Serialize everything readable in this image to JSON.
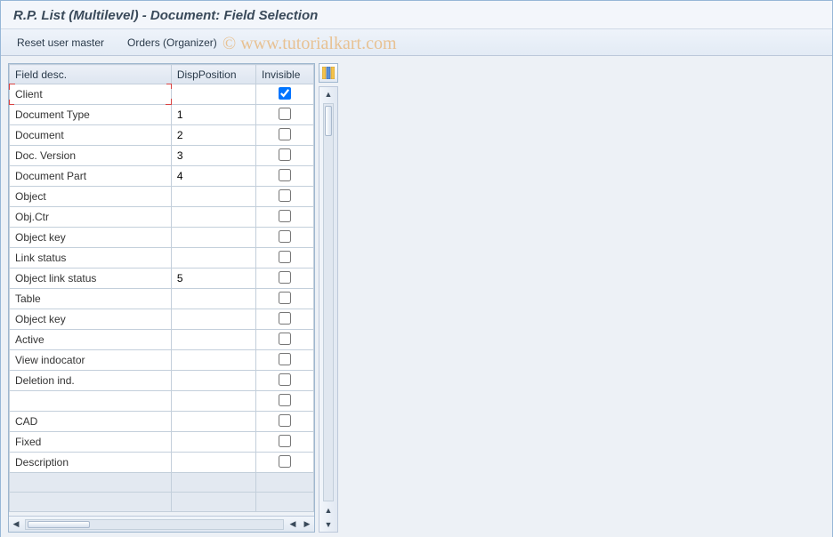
{
  "title": "R.P. List (Multilevel) - Document: Field Selection",
  "toolbar": {
    "reset_label": "Reset user master",
    "orders_label": "Orders (Organizer)"
  },
  "columns": {
    "field_desc": "Field desc.",
    "disp_position": "DispPosition",
    "invisible": "Invisible"
  },
  "rows": [
    {
      "desc": "Client",
      "pos": "",
      "inv": true,
      "focus": true
    },
    {
      "desc": "Document Type",
      "pos": "1",
      "inv": false
    },
    {
      "desc": "Document",
      "pos": "2",
      "inv": false
    },
    {
      "desc": "Doc. Version",
      "pos": "3",
      "inv": false
    },
    {
      "desc": "Document Part",
      "pos": "4",
      "inv": false
    },
    {
      "desc": "Object",
      "pos": "",
      "inv": false
    },
    {
      "desc": "Obj.Ctr",
      "pos": "",
      "inv": false
    },
    {
      "desc": "Object key",
      "pos": "",
      "inv": false
    },
    {
      "desc": "Link status",
      "pos": "",
      "inv": false
    },
    {
      "desc": "Object link status",
      "pos": "5",
      "inv": false
    },
    {
      "desc": "Table",
      "pos": "",
      "inv": false
    },
    {
      "desc": "Object key",
      "pos": "",
      "inv": false
    },
    {
      "desc": "Active",
      "pos": "",
      "inv": false
    },
    {
      "desc": "View indocator",
      "pos": "",
      "inv": false
    },
    {
      "desc": "Deletion ind.",
      "pos": "",
      "inv": false
    },
    {
      "desc": "",
      "pos": "",
      "inv": false
    },
    {
      "desc": "CAD",
      "pos": "",
      "inv": false
    },
    {
      "desc": "Fixed",
      "pos": "",
      "inv": false
    },
    {
      "desc": "Description",
      "pos": "",
      "inv": false
    }
  ],
  "empty_rows": 2,
  "watermark": "© www.tutorialkart.com"
}
